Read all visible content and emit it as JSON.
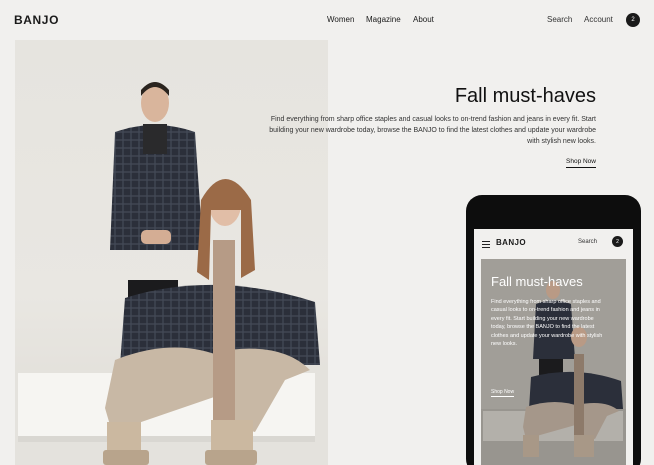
{
  "header": {
    "logo": "BANJO",
    "nav": [
      "Women",
      "Magazine",
      "About"
    ],
    "search_label": "Search",
    "account_label": "Account",
    "cart_count": "2"
  },
  "hero": {
    "title": "Fall must-haves",
    "description": "Find everything from sharp office staples and casual looks to on-trend fashion and jeans in every fit. Start building your new wardrobe today, browse the BANJO to find the latest clothes and update your wardrobe with stylish new looks.",
    "cta": "Shop Now"
  },
  "mobile": {
    "logo": "BANJO",
    "search_label": "Search",
    "cart_count": "2",
    "title": "Fall must-haves",
    "description": "Find everything from sharp office staples and casual looks to on-trend fashion and jeans in every fit. Start building your new wardrobe today, browse the BANJO to find the latest clothes and update your wardrobe with stylish new looks.",
    "cta": "Shop Now"
  },
  "colors": {
    "background": "#f1f0ee",
    "text": "#1a1a1a",
    "phone_body": "#0d0d0d"
  }
}
